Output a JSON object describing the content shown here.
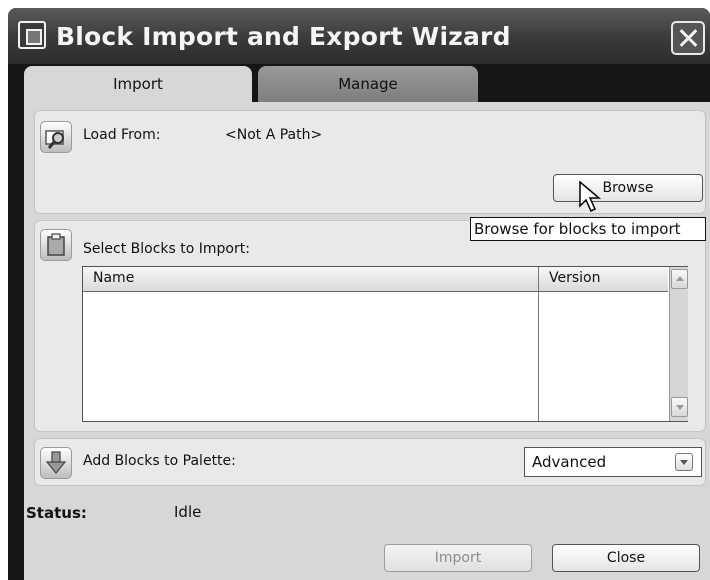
{
  "window": {
    "title": "Block Import and Export Wizard"
  },
  "tabs": [
    {
      "label": "Import",
      "active": true
    },
    {
      "label": "Manage",
      "active": false
    }
  ],
  "load_from": {
    "label": "Load From:",
    "path": "<Not A Path>",
    "browse_label": "Browse",
    "tooltip": "Browse for blocks to import"
  },
  "select_blocks": {
    "label": "Select Blocks to Import:",
    "columns": [
      "Name",
      "Version"
    ],
    "rows": []
  },
  "palette": {
    "label": "Add Blocks to Palette:",
    "selected": "Advanced"
  },
  "status": {
    "label": "Status:",
    "value": "Idle"
  },
  "footer": {
    "import_label": "Import",
    "close_label": "Close"
  },
  "icons": {
    "title": "app-icon",
    "close": "close-icon",
    "load": "search-folder-icon",
    "select": "clipboard-icon",
    "palette": "down-arrow-icon"
  },
  "colors": {
    "titlebar": "#3a3a3a",
    "panel": "#e9e9e9",
    "content": "#d7d7d7"
  }
}
